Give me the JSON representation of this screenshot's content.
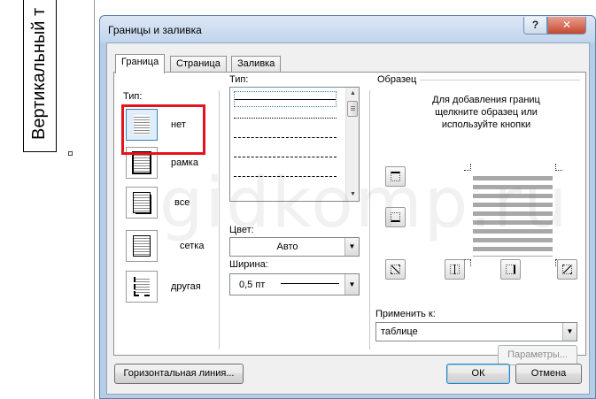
{
  "document": {
    "vertical_text": "Вертикальный т"
  },
  "dialog": {
    "title": "Границы и заливка",
    "help_button": "?",
    "close_button": "✕",
    "tabs": [
      {
        "label": "Граница",
        "active": true
      },
      {
        "label": "Страница",
        "active": false
      },
      {
        "label": "Заливка",
        "active": false
      }
    ],
    "setting": {
      "label": "Тип:",
      "presets": [
        {
          "label": "нет",
          "icon": "border-none-icon",
          "selected": true
        },
        {
          "label": "рамка",
          "icon": "border-box-icon"
        },
        {
          "label": "все",
          "icon": "border-all-icon"
        },
        {
          "label": "сетка",
          "icon": "border-grid-icon"
        },
        {
          "label": "другая",
          "icon": "border-custom-icon"
        }
      ]
    },
    "style": {
      "label": "Тип:",
      "items": [
        "solid",
        "dotted",
        "dashed-small",
        "dashed",
        "dash-dot"
      ],
      "selected_index": 0
    },
    "color": {
      "label": "Цвет:",
      "value": "Авто"
    },
    "width": {
      "label": "Ширина:",
      "value": "0,5 пт"
    },
    "preview": {
      "label": "Образец",
      "hint": "Для добавления границ щелкните образец или используйте кнопки"
    },
    "apply_to": {
      "label": "Применить к:",
      "value": "таблице"
    },
    "buttons": {
      "options": "Параметры...",
      "horizontal_line": "Горизонтальная линия...",
      "ok": "ОК",
      "cancel": "Отмена"
    },
    "watermark": "gidkomp.ru",
    "colors": {
      "highlight": "#e3141e",
      "title_bar": "#c2d5ec",
      "client_bg": "#f0f0f0"
    }
  }
}
